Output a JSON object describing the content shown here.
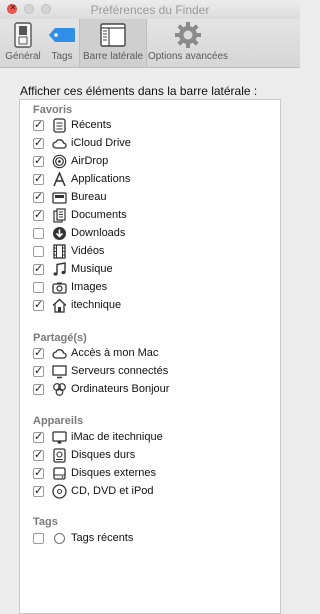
{
  "window": {
    "title": "Préférences du Finder"
  },
  "toolbar": {
    "items": [
      {
        "label": "Général",
        "icon": "switch-icon"
      },
      {
        "label": "Tags",
        "icon": "tag-icon"
      },
      {
        "label": "Barre latérale",
        "icon": "sidebar-icon",
        "selected": true
      },
      {
        "label": "Options avancées",
        "icon": "gear-icon"
      }
    ]
  },
  "panel": {
    "heading": "Afficher ces éléments dans la barre latérale :",
    "sections": [
      {
        "title": "Favoris",
        "items": [
          {
            "label": "Récents",
            "checked": true,
            "icon": "recents-icon"
          },
          {
            "label": "iCloud Drive",
            "checked": true,
            "icon": "cloud-icon"
          },
          {
            "label": "AirDrop",
            "checked": true,
            "icon": "airdrop-icon"
          },
          {
            "label": "Applications",
            "checked": true,
            "icon": "applications-icon"
          },
          {
            "label": "Bureau",
            "checked": true,
            "icon": "desktop-icon"
          },
          {
            "label": "Documents",
            "checked": true,
            "icon": "documents-icon"
          },
          {
            "label": "Downloads",
            "checked": false,
            "icon": "downloads-icon"
          },
          {
            "label": "Vidéos",
            "checked": false,
            "icon": "film-icon"
          },
          {
            "label": "Musique",
            "checked": true,
            "icon": "music-icon"
          },
          {
            "label": "Images",
            "checked": false,
            "icon": "camera-icon"
          },
          {
            "label": "itechnique",
            "checked": true,
            "icon": "home-icon"
          }
        ]
      },
      {
        "title": "Partagé(s)",
        "items": [
          {
            "label": "Accès à mon Mac",
            "checked": true,
            "icon": "cloud-icon"
          },
          {
            "label": "Serveurs connectés",
            "checked": true,
            "icon": "monitor-icon"
          },
          {
            "label": "Ordinateurs Bonjour",
            "checked": true,
            "icon": "bonjour-icon"
          }
        ]
      },
      {
        "title": "Appareils",
        "items": [
          {
            "label": "iMac de itechnique",
            "checked": true,
            "icon": "imac-icon"
          },
          {
            "label": "Disques durs",
            "checked": true,
            "icon": "harddisk-icon"
          },
          {
            "label": "Disques externes",
            "checked": true,
            "icon": "external-disk-icon"
          },
          {
            "label": "CD, DVD et iPod",
            "checked": true,
            "icon": "optical-disc-icon"
          }
        ]
      },
      {
        "title": "Tags",
        "items": [
          {
            "label": "Tags récents",
            "checked": false,
            "icon": "tag-circle-icon"
          }
        ]
      }
    ]
  }
}
